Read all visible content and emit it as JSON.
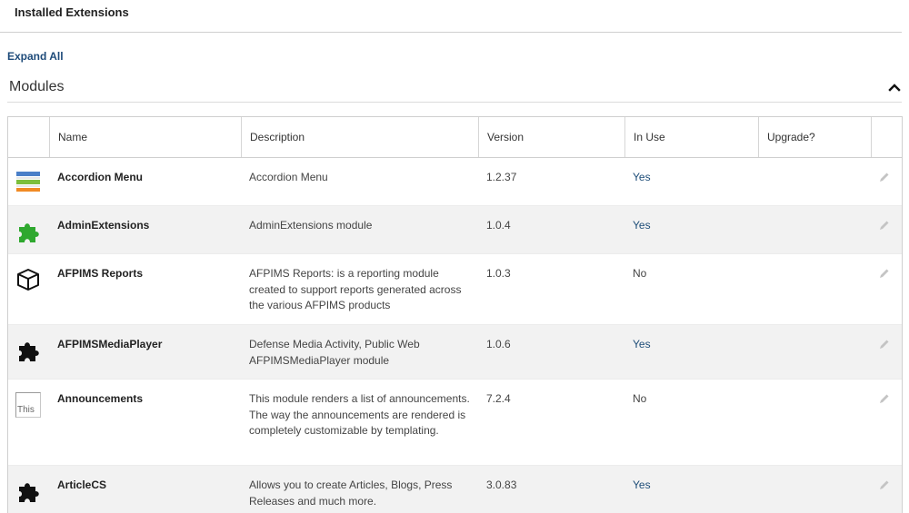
{
  "header": {
    "title": "Installed Extensions"
  },
  "expand_all_label": "Expand All",
  "section": {
    "title": "Modules",
    "collapse_icon": "chevron-up-icon"
  },
  "table": {
    "columns": [
      "Name",
      "Description",
      "Version",
      "In Use",
      "Upgrade?"
    ],
    "rows": [
      {
        "icon": "accordion-menu-icon",
        "name": "Accordion Menu",
        "description": "Accordion Menu",
        "version": "1.2.37",
        "in_use": "Yes",
        "upgrade": ""
      },
      {
        "icon": "green-puzzle-icon",
        "name": "AdminExtensions",
        "description": "AdminExtensions module",
        "version": "1.0.4",
        "in_use": "Yes",
        "upgrade": ""
      },
      {
        "icon": "cube-icon",
        "name": "AFPIMS Reports",
        "description": "AFPIMS Reports: is a reporting module created to support reports generated across the various AFPIMS products",
        "version": "1.0.3",
        "in_use": "No",
        "upgrade": ""
      },
      {
        "icon": "black-puzzle-icon",
        "name": "AFPIMSMediaPlayer",
        "description": "Defense Media Activity, Public Web AFPIMSMediaPlayer module",
        "version": "1.0.6",
        "in_use": "Yes",
        "upgrade": ""
      },
      {
        "icon": "broken-image-icon",
        "icon_alt": "This",
        "name": "Announcements",
        "description": "This module renders a list of announcements. The way the announcements are rendered is completely customizable by templating.",
        "version": "7.2.4",
        "in_use": "No",
        "upgrade": ""
      },
      {
        "icon": "black-puzzle-icon",
        "name": "ArticleCS",
        "description": "Allows you to create Articles, Blogs, Press Releases and much more.",
        "version": "3.0.83",
        "in_use": "Yes",
        "upgrade": ""
      }
    ]
  },
  "colors": {
    "link": "#1e4b7a",
    "in_use_yes": "#1f4e79",
    "alt_row": "#f2f2f2",
    "border": "#cfcfcf"
  }
}
